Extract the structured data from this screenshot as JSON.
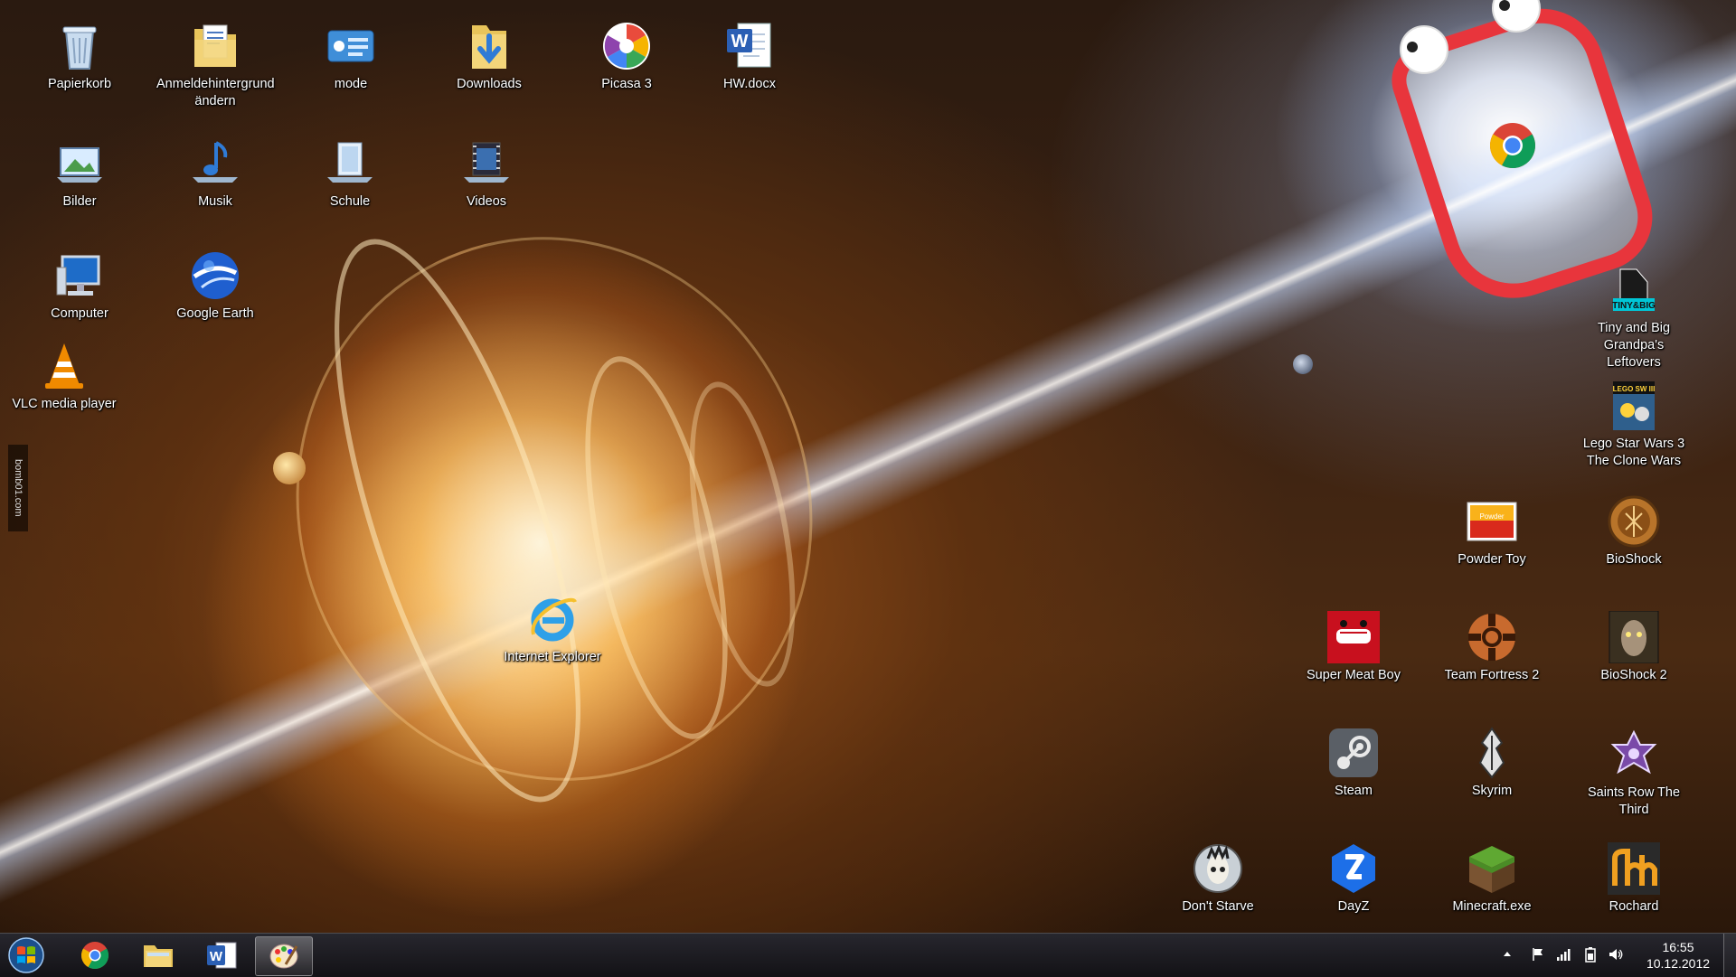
{
  "desktop": {
    "watermark": "bomb01.com",
    "icons": [
      {
        "label": "Papierkorb",
        "icon": "recycle-bin-icon"
      },
      {
        "label": "Anmeldehintergrund ändern",
        "icon": "folder-document-icon"
      },
      {
        "label": "mode",
        "icon": "mode-settings-icon"
      },
      {
        "label": "Downloads",
        "icon": "downloads-folder-icon"
      },
      {
        "label": "Picasa 3",
        "icon": "picasa-icon"
      },
      {
        "label": "HW.docx",
        "icon": "word-document-icon"
      },
      {
        "label": "Bilder",
        "icon": "pictures-library-icon"
      },
      {
        "label": "Musik",
        "icon": "music-library-icon"
      },
      {
        "label": "Schule",
        "icon": "school-folder-icon"
      },
      {
        "label": "Videos",
        "icon": "videos-library-icon"
      },
      {
        "label": "Computer",
        "icon": "computer-icon"
      },
      {
        "label": "Google Earth",
        "icon": "google-earth-icon"
      },
      {
        "label": "VLC media player",
        "icon": "vlc-icon"
      },
      {
        "label": "Internet Explorer",
        "icon": "internet-explorer-icon"
      },
      {
        "label": "Tiny and Big Grandpa's Leftovers",
        "icon": "tiny-and-big-icon"
      },
      {
        "label": "Lego Star Wars 3 The Clone Wars",
        "icon": "lego-star-wars-icon"
      },
      {
        "label": "Powder Toy",
        "icon": "powder-toy-icon"
      },
      {
        "label": "BioShock",
        "icon": "bioshock-icon"
      },
      {
        "label": "Super Meat Boy",
        "icon": "super-meat-boy-icon"
      },
      {
        "label": "Team Fortress 2",
        "icon": "team-fortress-2-icon"
      },
      {
        "label": "BioShock 2",
        "icon": "bioshock-2-icon"
      },
      {
        "label": "Steam",
        "icon": "steam-icon"
      },
      {
        "label": "Skyrim",
        "icon": "skyrim-icon"
      },
      {
        "label": "Saints Row The Third",
        "icon": "saints-row-icon"
      },
      {
        "label": "Don't Starve",
        "icon": "dont-starve-icon"
      },
      {
        "label": "DayZ",
        "icon": "dayz-icon"
      },
      {
        "label": "Minecraft.exe",
        "icon": "minecraft-icon"
      },
      {
        "label": "Rochard",
        "icon": "rochard-icon"
      }
    ]
  },
  "taskbar": {
    "pinned": [
      {
        "icon": "chrome-icon"
      },
      {
        "icon": "explorer-folder-icon"
      },
      {
        "icon": "word-icon"
      },
      {
        "icon": "paint-icon",
        "active": true
      }
    ],
    "tray": [
      "show-hidden-icons-icon",
      "action-center-flag-icon",
      "network-signal-icon",
      "battery-icon",
      "volume-icon"
    ],
    "clock": {
      "time": "16:55",
      "date": "10.12.2012"
    }
  },
  "colors": {
    "taskbar": "#16161a",
    "mascot_red": "#e8353c"
  }
}
